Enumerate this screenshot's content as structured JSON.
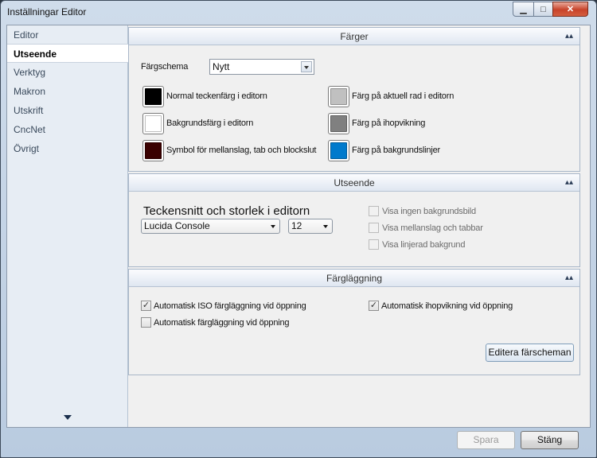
{
  "window": {
    "title": "Inställningar Editor"
  },
  "titlebar": {
    "minimize": "▁",
    "maximize": "□",
    "close": "✕"
  },
  "sidebar": {
    "items": [
      {
        "label": "Editor"
      },
      {
        "label": "Utseende"
      },
      {
        "label": "Verktyg"
      },
      {
        "label": "Makron"
      },
      {
        "label": "Utskrift"
      },
      {
        "label": "CncNet"
      },
      {
        "label": "Övrigt"
      }
    ]
  },
  "colors_section": {
    "title": "Färger",
    "scheme_label": "Färgschema",
    "scheme_value": "Nytt",
    "items": [
      {
        "label": "Normal teckenfärg i editorn",
        "color": "#000000"
      },
      {
        "label": "Bakgrundsfärg i editorn",
        "color": "#ffffff"
      },
      {
        "label": "Symbol för mellanslag, tab och blockslut",
        "color": "#3a0000"
      },
      {
        "label": "Färg på aktuell rad i editorn",
        "color": "#c0c0c0"
      },
      {
        "label": "Färg på ihopvikning",
        "color": "#808080"
      },
      {
        "label": "Färg på bakgrundslinjer",
        "color": "#007acc"
      }
    ]
  },
  "appearance_section": {
    "title": "Utseende",
    "font_label": "Teckensnitt och storlek i editorn",
    "font_value": "Lucida Console",
    "size_value": "12",
    "options": [
      {
        "label": "Visa ingen bakgrundsbild",
        "checked": false
      },
      {
        "label": "Visa mellanslag och tabbar",
        "checked": false
      },
      {
        "label": "Visa linjerad bakgrund",
        "checked": false
      }
    ]
  },
  "coloring_section": {
    "title": "Färgläggning",
    "options": [
      {
        "label": "Automatisk ISO färgläggning vid öppning",
        "checked": true
      },
      {
        "label": "Automatisk färgläggning vid öppning",
        "checked": false
      },
      {
        "label": "Automatisk ihopvikning vid öppning",
        "checked": true
      }
    ],
    "edit_button": "Editera färscheman"
  },
  "footer": {
    "apply": "Spara",
    "close": "Stäng"
  }
}
